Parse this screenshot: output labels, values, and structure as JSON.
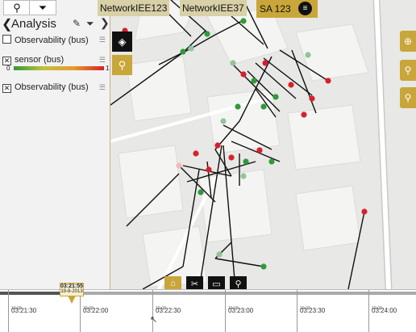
{
  "panel": {
    "tabs": [
      {
        "icon": "map-pin-icon",
        "glyph": "⚲"
      },
      {
        "icon": "filter-icon",
        "glyph": "⏷"
      }
    ],
    "back_glyph": "❮",
    "forward_glyph": "❯",
    "title": "Analysis",
    "layers": [
      {
        "label": "Observability (bus)",
        "checked": false
      },
      {
        "label": "sensor (bus)",
        "checked": true
      },
      {
        "label": "Observability (bus)",
        "checked": true
      }
    ],
    "legend": {
      "min": "0",
      "max": "1",
      "colors": [
        "#2f9a3a",
        "#c2c23a",
        "#e89a2a",
        "#d8202a"
      ]
    }
  },
  "top_labels": [
    "NetworkIEE123",
    "NetworkIEE37"
  ],
  "sa": {
    "label": "SA 123",
    "icon": "stack-icon"
  },
  "map_buttons": {
    "left": [
      {
        "icon": "layers-icon",
        "glyph": "◈",
        "color": "#111"
      },
      {
        "icon": "location-icon",
        "glyph": "⚲",
        "color": "#c9a63a"
      }
    ],
    "right": [
      {
        "icon": "globe-icon",
        "glyph": "⊕"
      },
      {
        "icon": "search-icon",
        "glyph": "⚲"
      },
      {
        "icon": "pin-icon",
        "glyph": "⚲"
      }
    ],
    "bottom": [
      {
        "icon": "home-icon",
        "glyph": "⌂",
        "color": "#c9a63a"
      },
      {
        "icon": "scissors-icon",
        "glyph": "✂"
      },
      {
        "icon": "monitor-icon",
        "glyph": "▭"
      },
      {
        "icon": "pin-icon",
        "glyph": "⚲"
      }
    ]
  },
  "timeline": {
    "marker_time": "03:21:55",
    "marker_date": "19-8-2013",
    "ticks": [
      {
        "date": "19-08",
        "time": "03:21:30"
      },
      {
        "date": "19-08",
        "time": "03:22:00"
      },
      {
        "date": "19-08",
        "time": "03:22:30"
      },
      {
        "date": "19-08",
        "time": "03:23:00"
      },
      {
        "date": "19-08",
        "time": "03:23:30"
      },
      {
        "date": "19-08",
        "time": "03:24:00"
      }
    ]
  },
  "colors": {
    "accent": "#c9a63a",
    "sensor_red": "#d8202a",
    "sensor_green": "#2f9a3a"
  }
}
